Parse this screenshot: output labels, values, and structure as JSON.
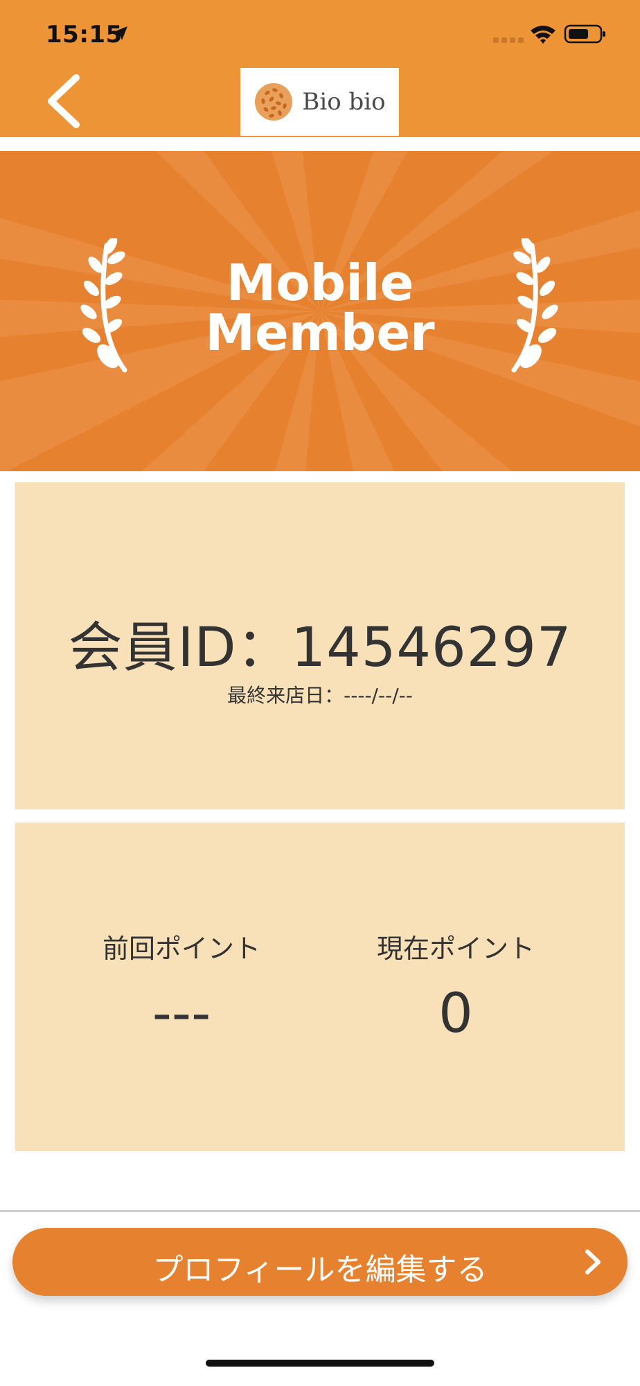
{
  "status_bar": {
    "time": "15:15",
    "icons": [
      "location-arrow-icon",
      "cellular-signal-icon",
      "wifi-icon",
      "battery-icon"
    ]
  },
  "header": {
    "back_icon": "chevron-left-icon",
    "logo_text": "Bio bio",
    "background_color": "#ED9437"
  },
  "banner": {
    "title_line1": "Mobile",
    "title_line2": "Member",
    "background_color": "#E6812F",
    "icons": [
      "laurel-left-icon",
      "laurel-right-icon"
    ]
  },
  "member": {
    "id_line": "会員ID：14546297",
    "last_visit": "最終来店日：----/--/--"
  },
  "points": {
    "previous_label": "前回ポイント",
    "previous_value": "---",
    "current_label": "現在ポイント",
    "current_value": "0"
  },
  "actions": {
    "edit_profile_label": "プロフィールを編集する",
    "edit_profile_icon": "chevron-right-icon"
  },
  "colors": {
    "accent": "#E6812F",
    "card": "#F8E1B8",
    "text": "#333333"
  }
}
